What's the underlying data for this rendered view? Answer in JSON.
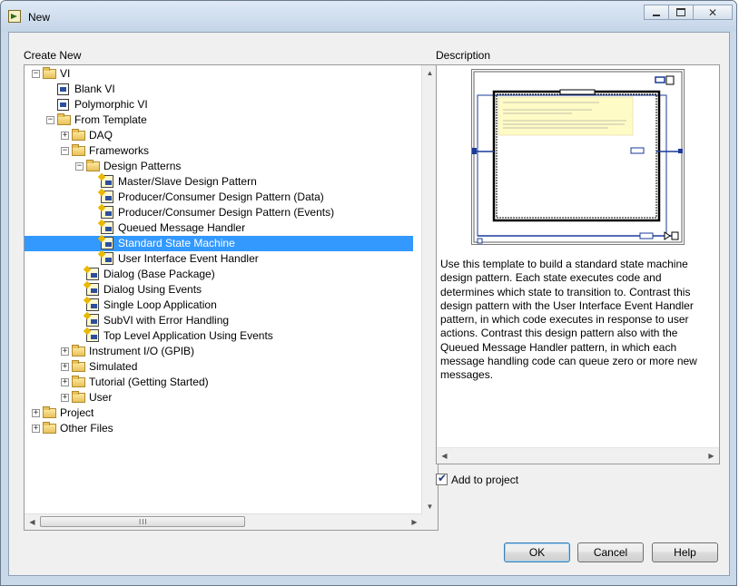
{
  "window": {
    "title": "New",
    "close_glyph": "✕"
  },
  "labels": {
    "create_new": "Create New",
    "description": "Description"
  },
  "tree": [
    {
      "label": "VI",
      "level": 0,
      "type": "folder",
      "expander": "−",
      "icon": "folder-icon"
    },
    {
      "label": "Blank VI",
      "level": 1,
      "type": "vi",
      "icon": "vi-icon"
    },
    {
      "label": "Polymorphic VI",
      "level": 1,
      "type": "vi",
      "icon": "vi-icon"
    },
    {
      "label": "From Template",
      "level": 1,
      "type": "folder",
      "expander": "−",
      "icon": "folder-icon"
    },
    {
      "label": "DAQ",
      "level": 2,
      "type": "folder",
      "expander": "+",
      "icon": "folder-icon"
    },
    {
      "label": "Frameworks",
      "level": 2,
      "type": "folder",
      "expander": "−",
      "icon": "folder-icon"
    },
    {
      "label": "Design Patterns",
      "level": 3,
      "type": "folder",
      "expander": "−",
      "icon": "folder-icon"
    },
    {
      "label": "Master/Slave Design Pattern",
      "level": 4,
      "type": "template",
      "icon": "template-icon"
    },
    {
      "label": "Producer/Consumer Design Pattern (Data)",
      "level": 4,
      "type": "template",
      "icon": "template-icon"
    },
    {
      "label": "Producer/Consumer Design Pattern (Events)",
      "level": 4,
      "type": "template",
      "icon": "template-icon"
    },
    {
      "label": "Queued Message Handler",
      "level": 4,
      "type": "template",
      "icon": "template-icon"
    },
    {
      "label": "Standard State Machine",
      "level": 4,
      "type": "template",
      "icon": "template-icon",
      "selected": true
    },
    {
      "label": "User Interface Event Handler",
      "level": 4,
      "type": "template",
      "icon": "template-icon"
    },
    {
      "label": "Dialog (Base Package)",
      "level": 3,
      "type": "template",
      "icon": "template-icon"
    },
    {
      "label": "Dialog Using Events",
      "level": 3,
      "type": "template",
      "icon": "template-icon"
    },
    {
      "label": "Single Loop Application",
      "level": 3,
      "type": "template",
      "icon": "template-icon"
    },
    {
      "label": "SubVI with Error Handling",
      "level": 3,
      "type": "template",
      "icon": "template-icon"
    },
    {
      "label": "Top Level Application Using Events",
      "level": 3,
      "type": "template",
      "icon": "template-icon"
    },
    {
      "label": "Instrument I/O (GPIB)",
      "level": 2,
      "type": "folder",
      "expander": "+",
      "icon": "folder-icon"
    },
    {
      "label": "Simulated",
      "level": 2,
      "type": "folder",
      "expander": "+",
      "icon": "folder-icon"
    },
    {
      "label": "Tutorial (Getting Started)",
      "level": 2,
      "type": "folder",
      "expander": "+",
      "icon": "folder-icon"
    },
    {
      "label": "User",
      "level": 2,
      "type": "folder",
      "expander": "+",
      "icon": "folder-icon"
    },
    {
      "label": "Project",
      "level": 0,
      "type": "folder",
      "expander": "+",
      "icon": "folder-icon"
    },
    {
      "label": "Other Files",
      "level": 0,
      "type": "folder",
      "expander": "+",
      "icon": "folder-icon"
    }
  ],
  "scroll_glyphs": {
    "up": "▲",
    "down": "▼",
    "left": "◀",
    "right": "▶",
    "grip": "III"
  },
  "description": {
    "text": "Use this template to build a standard state machine design pattern. Each state executes code and determines which state to transition to. Contrast this design pattern with the User Interface Event Handler pattern, in which code executes in response to user actions. Contrast this design pattern also with the Queued Message Handler pattern, in which each message handling code can queue zero or more new messages."
  },
  "add_to_project": {
    "label": "Add to project",
    "checked": true,
    "check_glyph": "✔"
  },
  "buttons": {
    "ok": "OK",
    "cancel": "Cancel",
    "help": "Help"
  }
}
